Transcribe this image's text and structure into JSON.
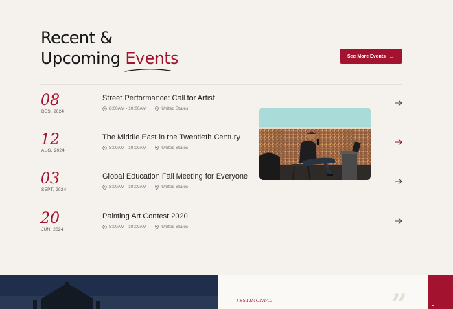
{
  "section": {
    "heading_line1": "Recent &",
    "heading_line2_prefix": "Upcoming ",
    "heading_accent": "Events",
    "see_more_label": "See More Events"
  },
  "events": [
    {
      "day": "08",
      "month": "DES, 2024",
      "title": "Street Performance: Call for Artist",
      "time": "8:00AM - 10:00AM",
      "location": "United States"
    },
    {
      "day": "12",
      "month": "AUG, 2024",
      "title": "The Middle East in the Twentieth Century",
      "time": "8:00AM - 10:00AM",
      "location": "United States"
    },
    {
      "day": "03",
      "month": "SEPT, 2024",
      "title": "Global Education Fall Meeting for Everyone",
      "time": "8:00AM - 10:00AM",
      "location": "United States"
    },
    {
      "day": "20",
      "month": "JUN, 2024",
      "title": "Painting Art Contest 2020",
      "time": "8:00AM - 10:00AM",
      "location": "United States"
    }
  ],
  "testimonial": {
    "label": "TESTIMONIAL",
    "quote_mark": "”"
  },
  "colors": {
    "accent": "#a3122e",
    "background": "#f5f2ee",
    "text": "#1c1c1c",
    "muted": "#6b6b6b"
  },
  "icons": {
    "time": "clock-icon",
    "location": "map-pin-icon",
    "row_link": "arrow-right-icon"
  }
}
